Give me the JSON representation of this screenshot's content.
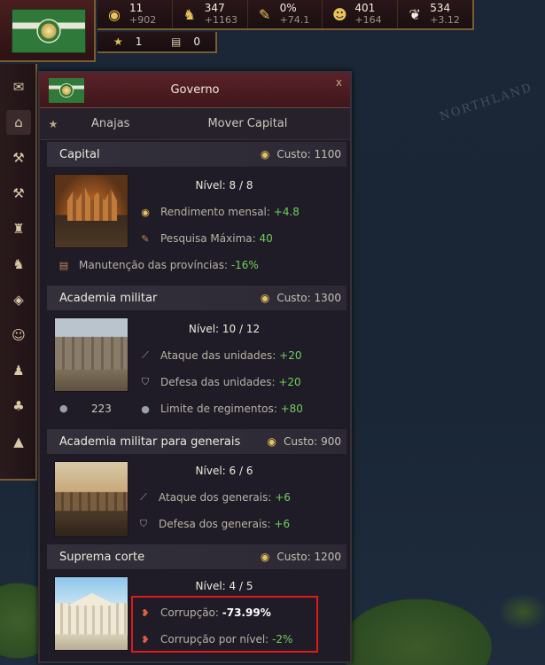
{
  "map": {
    "label": "NORTHLAND"
  },
  "topbar": {
    "resources": [
      {
        "icon": "gold-coins-icon",
        "glyph": "◉",
        "value": "11",
        "delta": "+902"
      },
      {
        "icon": "manpower-icon",
        "glyph": "♞",
        "value": "347",
        "delta": "+1163"
      },
      {
        "icon": "research-icon",
        "glyph": "✎",
        "value": "0%",
        "delta": "+74.1"
      },
      {
        "icon": "population-icon",
        "glyph": "☻",
        "value": "401",
        "delta": "+164"
      },
      {
        "icon": "dove-icon",
        "glyph": "❦",
        "value": "534",
        "delta": "+3.12"
      }
    ],
    "sub": [
      {
        "icon": "star-icon",
        "glyph": "★",
        "value": "1"
      },
      {
        "icon": "scroll-icon",
        "glyph": "▤",
        "value": "0"
      }
    ]
  },
  "sidebar": {
    "items": [
      {
        "name": "sidebar-book-icon",
        "glyph": "✉"
      },
      {
        "name": "sidebar-government-icon",
        "glyph": "⌂"
      },
      {
        "name": "sidebar-hammer-icon",
        "glyph": "⚒"
      },
      {
        "name": "sidebar-build-icon",
        "glyph": "⚒"
      },
      {
        "name": "sidebar-economy-icon",
        "glyph": "♜"
      },
      {
        "name": "sidebar-army-icon",
        "glyph": "♞"
      },
      {
        "name": "sidebar-map-icon",
        "glyph": "◈"
      },
      {
        "name": "sidebar-diplomacy-icon",
        "glyph": "☺"
      },
      {
        "name": "sidebar-people-icon",
        "glyph": "♟"
      },
      {
        "name": "sidebar-tree-icon",
        "glyph": "♣"
      },
      {
        "name": "sidebar-religion-icon",
        "glyph": "▲"
      }
    ]
  },
  "panel": {
    "title": "Governo",
    "close": "x",
    "tabs": {
      "anajas": "Anajas",
      "mover": "Mover Capital"
    },
    "sections": {
      "capital": {
        "title": "Capital",
        "cost": "Custo: 1100",
        "level": "Nível: 8 / 8",
        "stats": [
          {
            "label": "Rendimento mensal: ",
            "value": "+4.8"
          },
          {
            "label": "Pesquisa Máxima: ",
            "value": "40"
          }
        ],
        "upkeep_label": "Manutenção das províncias: ",
        "upkeep_value": "-16%"
      },
      "academia": {
        "title": "Academia militar",
        "cost": "Custo: 1300",
        "level": "Nível: 10 / 12",
        "count": "223",
        "stats": [
          {
            "label": "Ataque das unidades: ",
            "value": "+20"
          },
          {
            "label": "Defesa das unidades: ",
            "value": "+20"
          },
          {
            "label": "Limite de regimentos: ",
            "value": "+80"
          }
        ]
      },
      "generais": {
        "title": "Academia militar para generais",
        "cost": "Custo: 900",
        "level": "Nível: 6 / 6",
        "stats": [
          {
            "label": "Ataque dos generais: ",
            "value": "+6"
          },
          {
            "label": "Defesa dos generais: ",
            "value": "+6"
          }
        ]
      },
      "corte": {
        "title": "Suprema corte",
        "cost": "Custo: 1200",
        "level": "Nível: 4 / 5",
        "stats": [
          {
            "label": "Corrupção: ",
            "value": "-73.99%"
          },
          {
            "label": "Corrupção por nível: ",
            "value": "-2%"
          }
        ]
      }
    }
  }
}
